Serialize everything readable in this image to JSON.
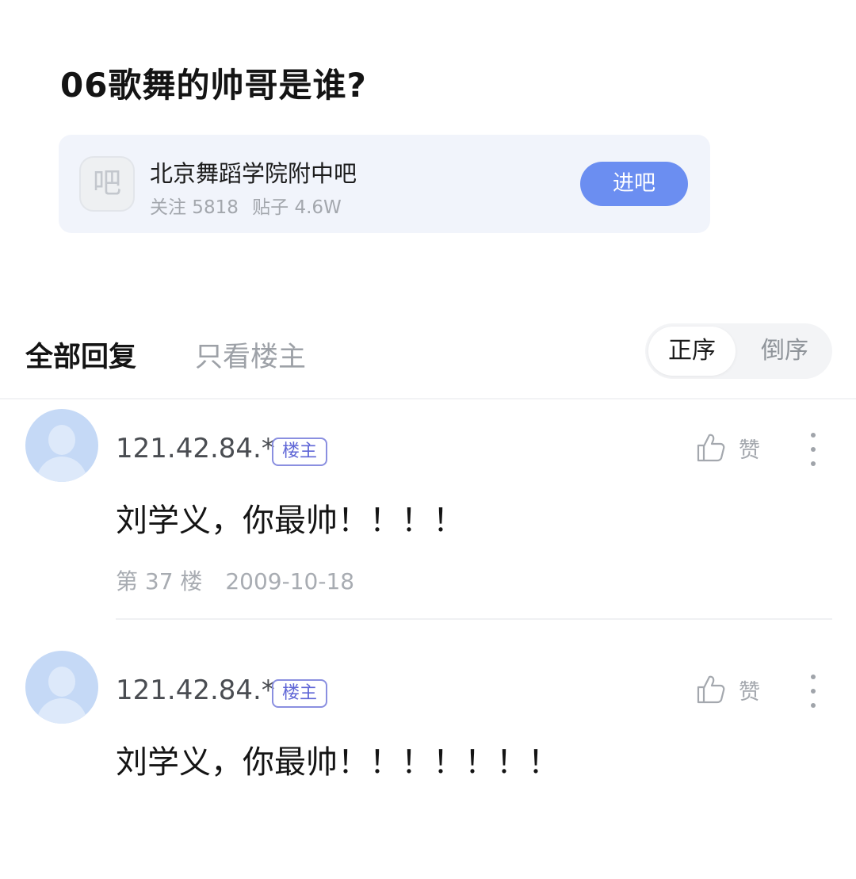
{
  "post": {
    "title": "06歌舞的帅哥是谁?"
  },
  "forum": {
    "avatar_glyph": "吧",
    "name": "北京舞蹈学院附中吧",
    "followers": "关注 5818",
    "posts": "贴子 4.6W",
    "enter_label": "进吧",
    "enter_color": "#6b8ef1"
  },
  "tabs": {
    "all_replies": "全部回复",
    "op_only": "只看楼主",
    "sort_asc": "正序",
    "sort_desc": "倒序"
  },
  "replies": [
    {
      "user": "121.42.84.*",
      "badge": "楼主",
      "like_label": "赞",
      "content": "刘学义，你最帅！！！！",
      "floor": "第 37 楼",
      "date": "2009-10-18"
    },
    {
      "user": "121.42.84.*",
      "badge": "楼主",
      "like_label": "赞",
      "content": "刘学义，你最帅！！！！！！！"
    }
  ],
  "icons": {
    "avatar": "default-user-avatar-icon",
    "like": "thumbs-up-icon",
    "more": "more-vertical-icon"
  }
}
